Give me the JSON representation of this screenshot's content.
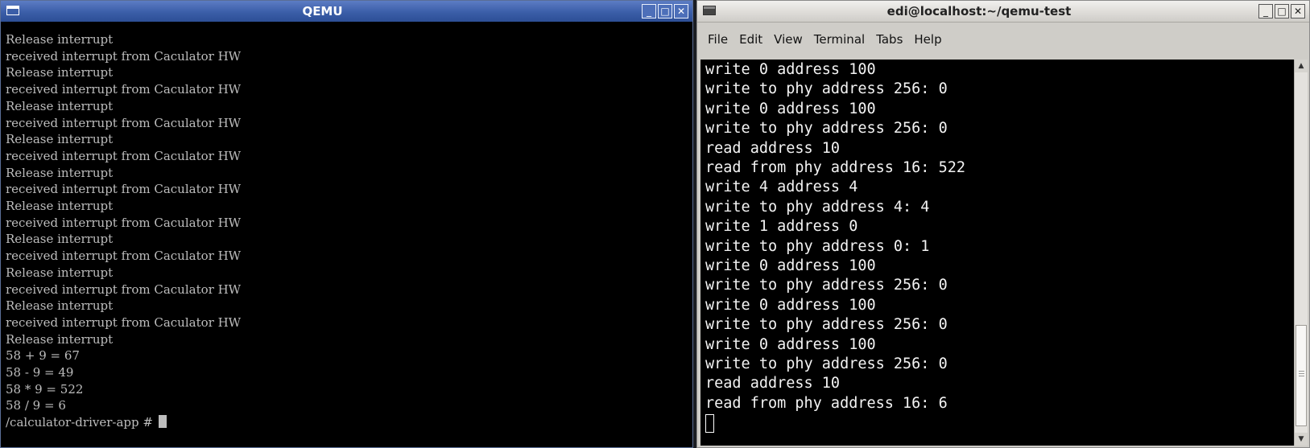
{
  "qemu_window": {
    "title": "QEMU",
    "lines": [
      "Release interrupt",
      "received interrupt from Caculator HW",
      "Release interrupt",
      "received interrupt from Caculator HW",
      "Release interrupt",
      "received interrupt from Caculator HW",
      "Release interrupt",
      "received interrupt from Caculator HW",
      "Release interrupt",
      "received interrupt from Caculator HW",
      "Release interrupt",
      "received interrupt from Caculator HW",
      "Release interrupt",
      "received interrupt from Caculator HW",
      "Release interrupt",
      "received interrupt from Caculator HW",
      "Release interrupt",
      "received interrupt from Caculator HW",
      "Release interrupt",
      "58 + 9 = 67",
      "58 - 9 = 49",
      "58 * 9 = 522",
      "58 / 9 = 6"
    ],
    "prompt": "/calculator-driver-app # "
  },
  "terminal_window": {
    "title": "edi@localhost:~/qemu-test",
    "menu": [
      "File",
      "Edit",
      "View",
      "Terminal",
      "Tabs",
      "Help"
    ],
    "lines": [
      "write 0 address 100",
      "write to phy address 256: 0",
      "write 0 address 100",
      "write to phy address 256: 0",
      "read address 10",
      "read from phy address 16: 522",
      "write 4 address 4",
      "write to phy address 4: 4",
      "write 1 address 0",
      "write to phy address 0: 1",
      "write 0 address 100",
      "write to phy address 256: 0",
      "write 0 address 100",
      "write to phy address 256: 0",
      "write 0 address 100",
      "write to phy address 256: 0",
      "read address 10",
      "read from phy address 16: 6"
    ]
  },
  "window_buttons": {
    "minimize": "_",
    "maximize": "□",
    "close": "✕"
  },
  "icons": {
    "window_menu": "window-menu-icon",
    "terminal": "terminal-icon"
  }
}
